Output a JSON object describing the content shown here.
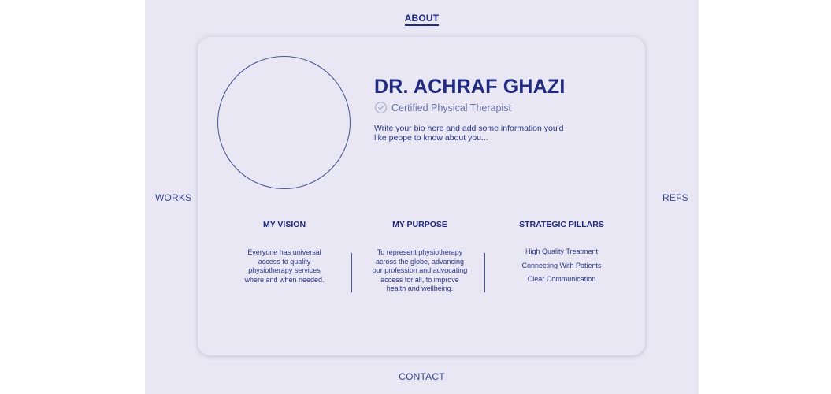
{
  "nav": {
    "about": "ABOUT",
    "works": "WORKS",
    "refs": "REFS",
    "contact": "CONTACT"
  },
  "profile": {
    "name": "DR. ACHRAF GHAZI",
    "title": "Certified Physical Therapist",
    "check_icon": "check-circle-icon",
    "bio": "Write your bio here and add some information you'd like peope to know about you..."
  },
  "sections": {
    "vision": {
      "heading": "MY VISION",
      "text": "Everyone has universal access to quality physiotherapy services where and when needed."
    },
    "purpose": {
      "heading": "MY PURPOSE",
      "text": "To represent physiotherapy across the globe, advancing our profession and advocating access for all, to improve health and wellbeing."
    },
    "pillars": {
      "heading": "STRATEGIC PILLARS",
      "items": [
        "High Quality Treatment",
        "Connecting With Patients",
        "Clear Communication"
      ]
    }
  },
  "colors": {
    "page_bg": "#e8e7f3",
    "accent": "#1f2a80",
    "muted": "#6a70a6"
  }
}
